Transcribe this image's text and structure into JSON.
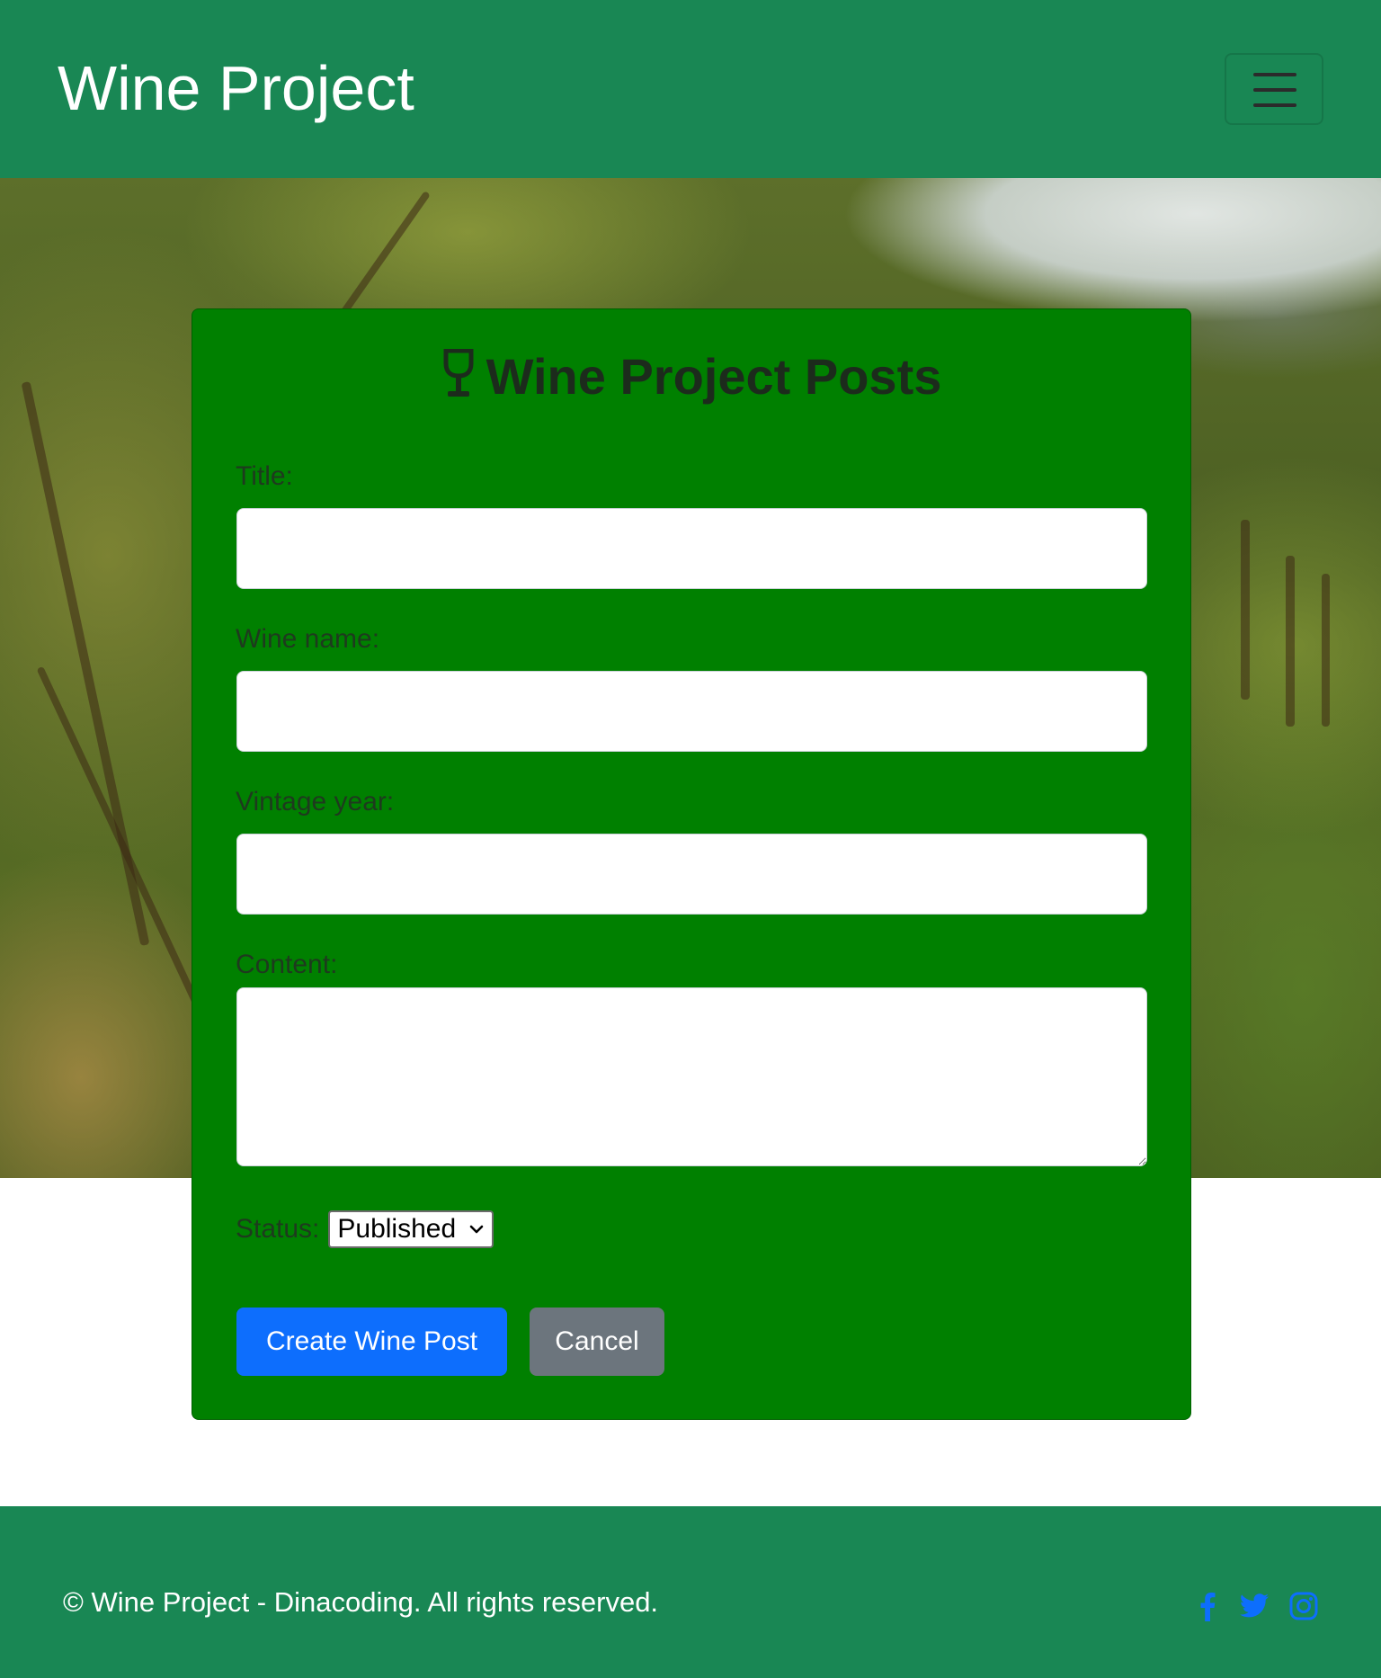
{
  "navbar": {
    "brand": "Wine Project",
    "toggler_icon": "hamburger-menu-icon"
  },
  "hero": {
    "background": "vineyard-photo"
  },
  "form": {
    "heading_icon": "wine-glass-icon",
    "heading": "Wine Project Posts",
    "fields": {
      "title": {
        "label": "Title:",
        "value": ""
      },
      "wine_name": {
        "label": "Wine name:",
        "value": ""
      },
      "vintage_year": {
        "label": "Vintage year:",
        "value": ""
      },
      "content": {
        "label": "Content:",
        "value": ""
      }
    },
    "status": {
      "label": "Status:",
      "selected": "Published"
    },
    "buttons": {
      "create": "Create Wine Post",
      "cancel": "Cancel"
    }
  },
  "footer": {
    "copyright": "© Wine Project - Dinacoding. All rights reserved.",
    "social_icons": [
      "facebook-icon",
      "twitter-icon",
      "instagram-icon"
    ]
  },
  "colors": {
    "navbar_bg": "#198754",
    "card_bg": "#008000",
    "primary_button": "#0d6efd",
    "secondary_button": "#6c757d",
    "social_icons": "#0d6efd"
  }
}
